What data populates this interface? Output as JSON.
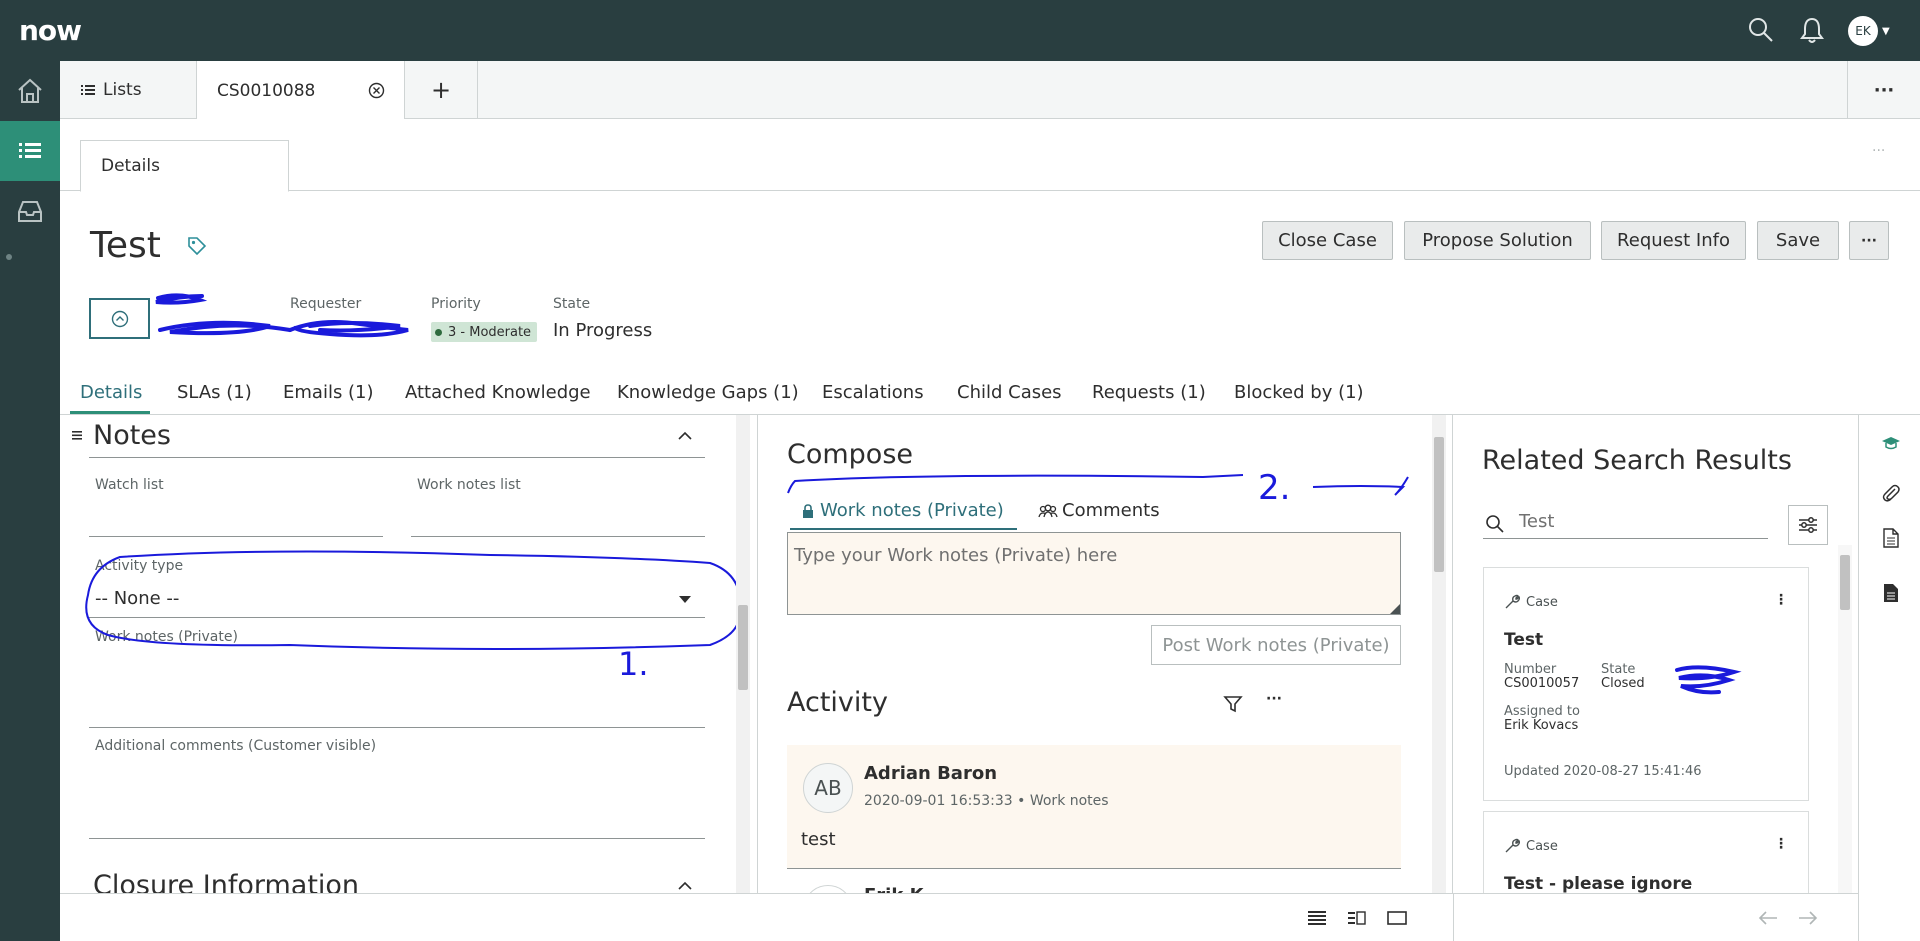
{
  "app": {
    "logo": "now",
    "avatar_initials": "EK"
  },
  "tabs": {
    "lists_label": "Lists",
    "record_label": "CS0010088",
    "add_label": "+",
    "more_label": "···"
  },
  "subtab": {
    "details_label": "Details",
    "more_label": "···"
  },
  "record": {
    "title": "Test",
    "requester_label": "Requester",
    "priority_label": "Priority",
    "priority_value": "3 - Moderate",
    "state_label": "State",
    "state_value": "In Progress"
  },
  "actions": {
    "close_case": "Close Case",
    "propose_solution": "Propose Solution",
    "request_info": "Request Info",
    "save": "Save",
    "more": "···"
  },
  "record_tabs": [
    "Details",
    "SLAs (1)",
    "Emails (1)",
    "Attached Knowledge",
    "Knowledge Gaps (1)",
    "Escalations",
    "Child Cases",
    "Requests (1)",
    "Blocked by (1)"
  ],
  "notes": {
    "section_title": "Notes",
    "watch_list_label": "Watch list",
    "work_notes_list_label": "Work notes list",
    "activity_type_label": "Activity type",
    "activity_type_value": "-- None --",
    "work_notes_label": "Work notes (Private)",
    "additional_comments_label": "Additional comments (Customer visible)",
    "closure_title": "Closure Information"
  },
  "annotations": {
    "one": "1.",
    "two": "2."
  },
  "compose": {
    "title": "Compose",
    "tab_work_notes": "Work notes (Private)",
    "tab_comments": "Comments",
    "textarea_placeholder": "Type your Work notes (Private) here",
    "post_button": "Post Work notes (Private)"
  },
  "activity": {
    "title": "Activity",
    "entry": {
      "initials": "AB",
      "author": "Adrian Baron",
      "meta": "2020-09-01 16:53:33 • Work notes",
      "text": "test"
    },
    "next_author": "Erik K"
  },
  "related": {
    "title": "Related Search Results",
    "search_value": "Test",
    "cards": [
      {
        "type": "Case",
        "title": "Test",
        "number_label": "Number",
        "number_value": "CS0010057",
        "state_label": "State",
        "state_value": "Closed",
        "assigned_label": "Assigned to",
        "assigned_value": "Erik Kovacs",
        "updated": "Updated 2020-08-27 15:41:46"
      },
      {
        "type": "Case",
        "title": "Test - please ignore"
      }
    ]
  },
  "colors": {
    "header": "#293e40",
    "accent": "#2d8f78",
    "annotation": "#1a1adb"
  }
}
